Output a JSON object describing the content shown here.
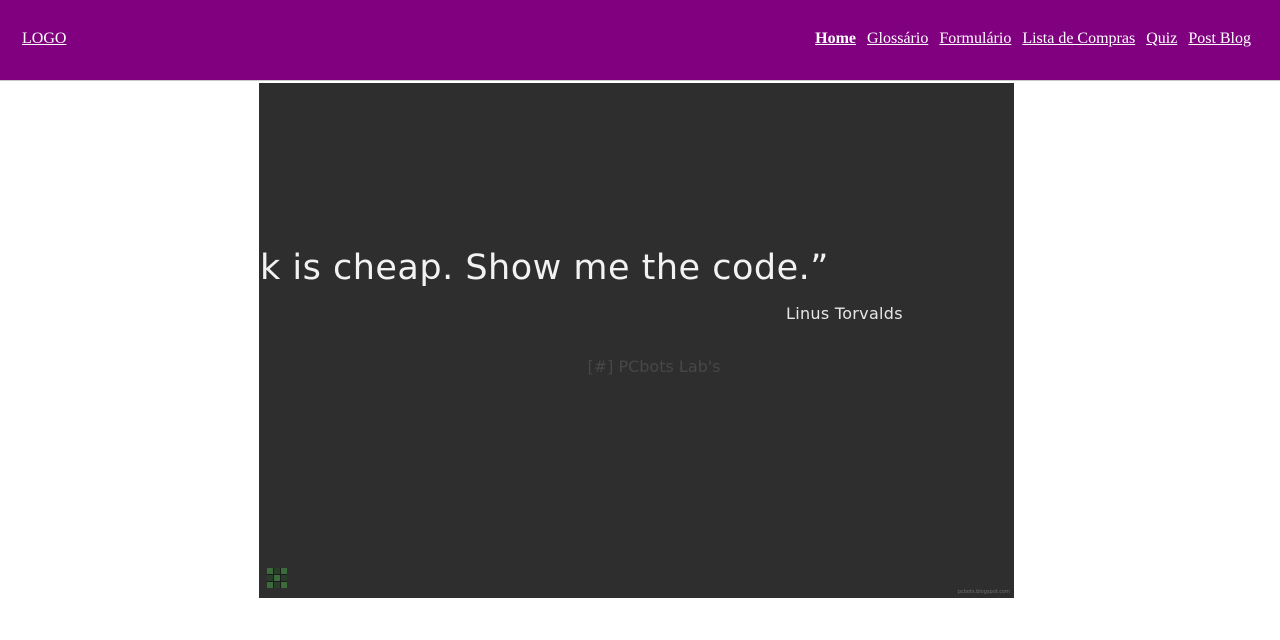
{
  "header": {
    "logo": "LOGO",
    "nav": [
      {
        "label": "Home",
        "active": true
      },
      {
        "label": "Glossário",
        "active": false
      },
      {
        "label": "Formulário",
        "active": false
      },
      {
        "label": "Lista de Compras",
        "active": false
      },
      {
        "label": "Quiz",
        "active": false
      },
      {
        "label": "Post Blog",
        "active": false
      }
    ],
    "background_color": "#800080"
  },
  "hero": {
    "quote": "“Talk is cheap. Show me the code.”",
    "author": "Linus Torvalds",
    "watermark": "[#] PCbots Lab's",
    "site_credit": "pcbots.blogspot.com",
    "background_color": "#2e2e2e",
    "corner_icon": "grid-icon"
  }
}
